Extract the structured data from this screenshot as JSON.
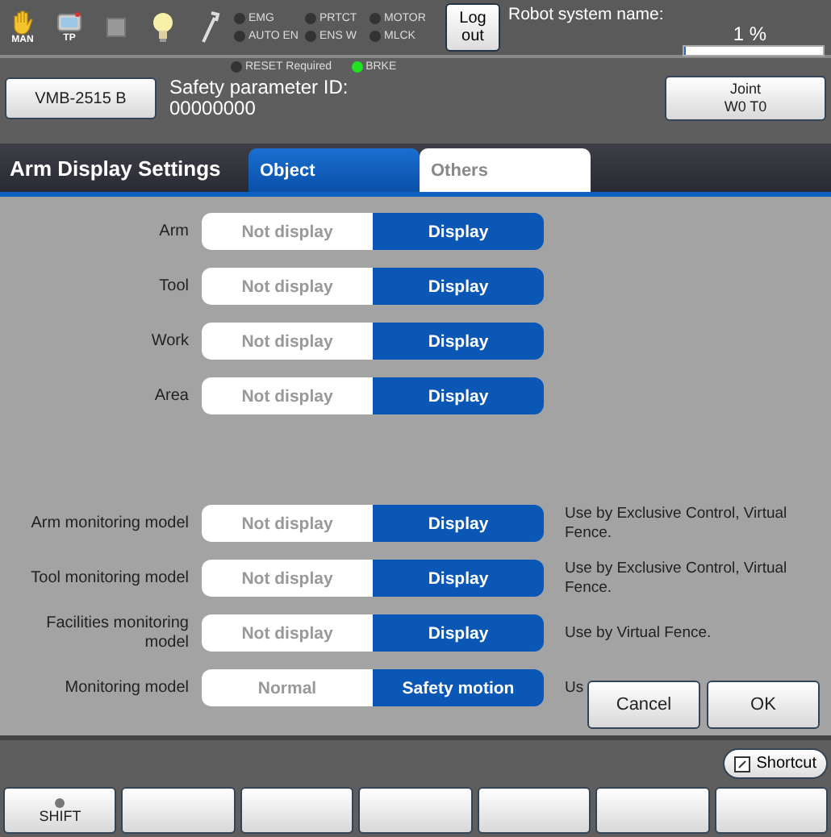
{
  "status_icons": [
    {
      "kind": "hand",
      "label": "MAN"
    },
    {
      "kind": "pendant",
      "label": "TP"
    },
    {
      "kind": "stop"
    },
    {
      "kind": "bulb"
    },
    {
      "kind": "wrench"
    }
  ],
  "lamps": [
    {
      "label": "EMG",
      "on": false
    },
    {
      "label": "PRTCT",
      "on": false
    },
    {
      "label": "MOTOR",
      "on": false
    },
    {
      "label": "AUTO EN",
      "on": false
    },
    {
      "label": "ENS W",
      "on": false
    },
    {
      "label": "MLCK",
      "on": false
    }
  ],
  "logout_button": "Log out",
  "robot_system": {
    "label": "Robot system name:",
    "speed": "1 %",
    "level": 0.01
  },
  "lamps_2": [
    {
      "label": "RESET Required",
      "on": false
    },
    {
      "label": "BRKE",
      "on": true
    }
  ],
  "robot_button": "VMB-2515 B",
  "safety_parameter": {
    "label": "Safety parameter ID:",
    "value": "00000000"
  },
  "coord_button": {
    "line_1": "Joint",
    "line_2": "W0 T0"
  },
  "title": "Arm Display Settings",
  "tabs": [
    {
      "label": "Object",
      "selected": true
    },
    {
      "label": "Others",
      "selected": false
    }
  ],
  "display_settings": [
    {
      "label": "Arm",
      "options": [
        {
          "label": "Not display",
          "selected": false
        },
        {
          "label": "Display",
          "selected": true
        }
      ]
    },
    {
      "label": "Tool",
      "options": [
        {
          "label": "Not display",
          "selected": false
        },
        {
          "label": "Display",
          "selected": true
        }
      ]
    },
    {
      "label": "Work",
      "options": [
        {
          "label": "Not display",
          "selected": false
        },
        {
          "label": "Display",
          "selected": true
        }
      ]
    },
    {
      "label": "Area",
      "options": [
        {
          "label": "Not display",
          "selected": false
        },
        {
          "label": "Display",
          "selected": true
        }
      ]
    }
  ],
  "monitoring_settings": [
    {
      "label": "Arm monitoring model",
      "note": "Use by Exclusive Control, Virtual Fence.",
      "options": [
        {
          "label": "Not display",
          "selected": false
        },
        {
          "label": "Display",
          "selected": true
        }
      ]
    },
    {
      "label": "Tool monitoring model",
      "note": "Use by Exclusive Control, Virtual Fence.",
      "options": [
        {
          "label": "Not display",
          "selected": false
        },
        {
          "label": "Display",
          "selected": true
        }
      ]
    },
    {
      "label": "Facilities monitoring model",
      "note": "Use by Virtual Fence.",
      "options": [
        {
          "label": "Not display",
          "selected": false
        },
        {
          "label": "Display",
          "selected": true
        }
      ]
    },
    {
      "label": "Monitoring model",
      "note": "Us",
      "options": [
        {
          "label": "Normal",
          "selected": false
        },
        {
          "label": "Safety motion",
          "selected": true
        }
      ]
    }
  ],
  "dialog_buttons": [
    "Cancel",
    "OK"
  ],
  "shortcut_button": "Shortcut",
  "shift_key": "SHIFT"
}
